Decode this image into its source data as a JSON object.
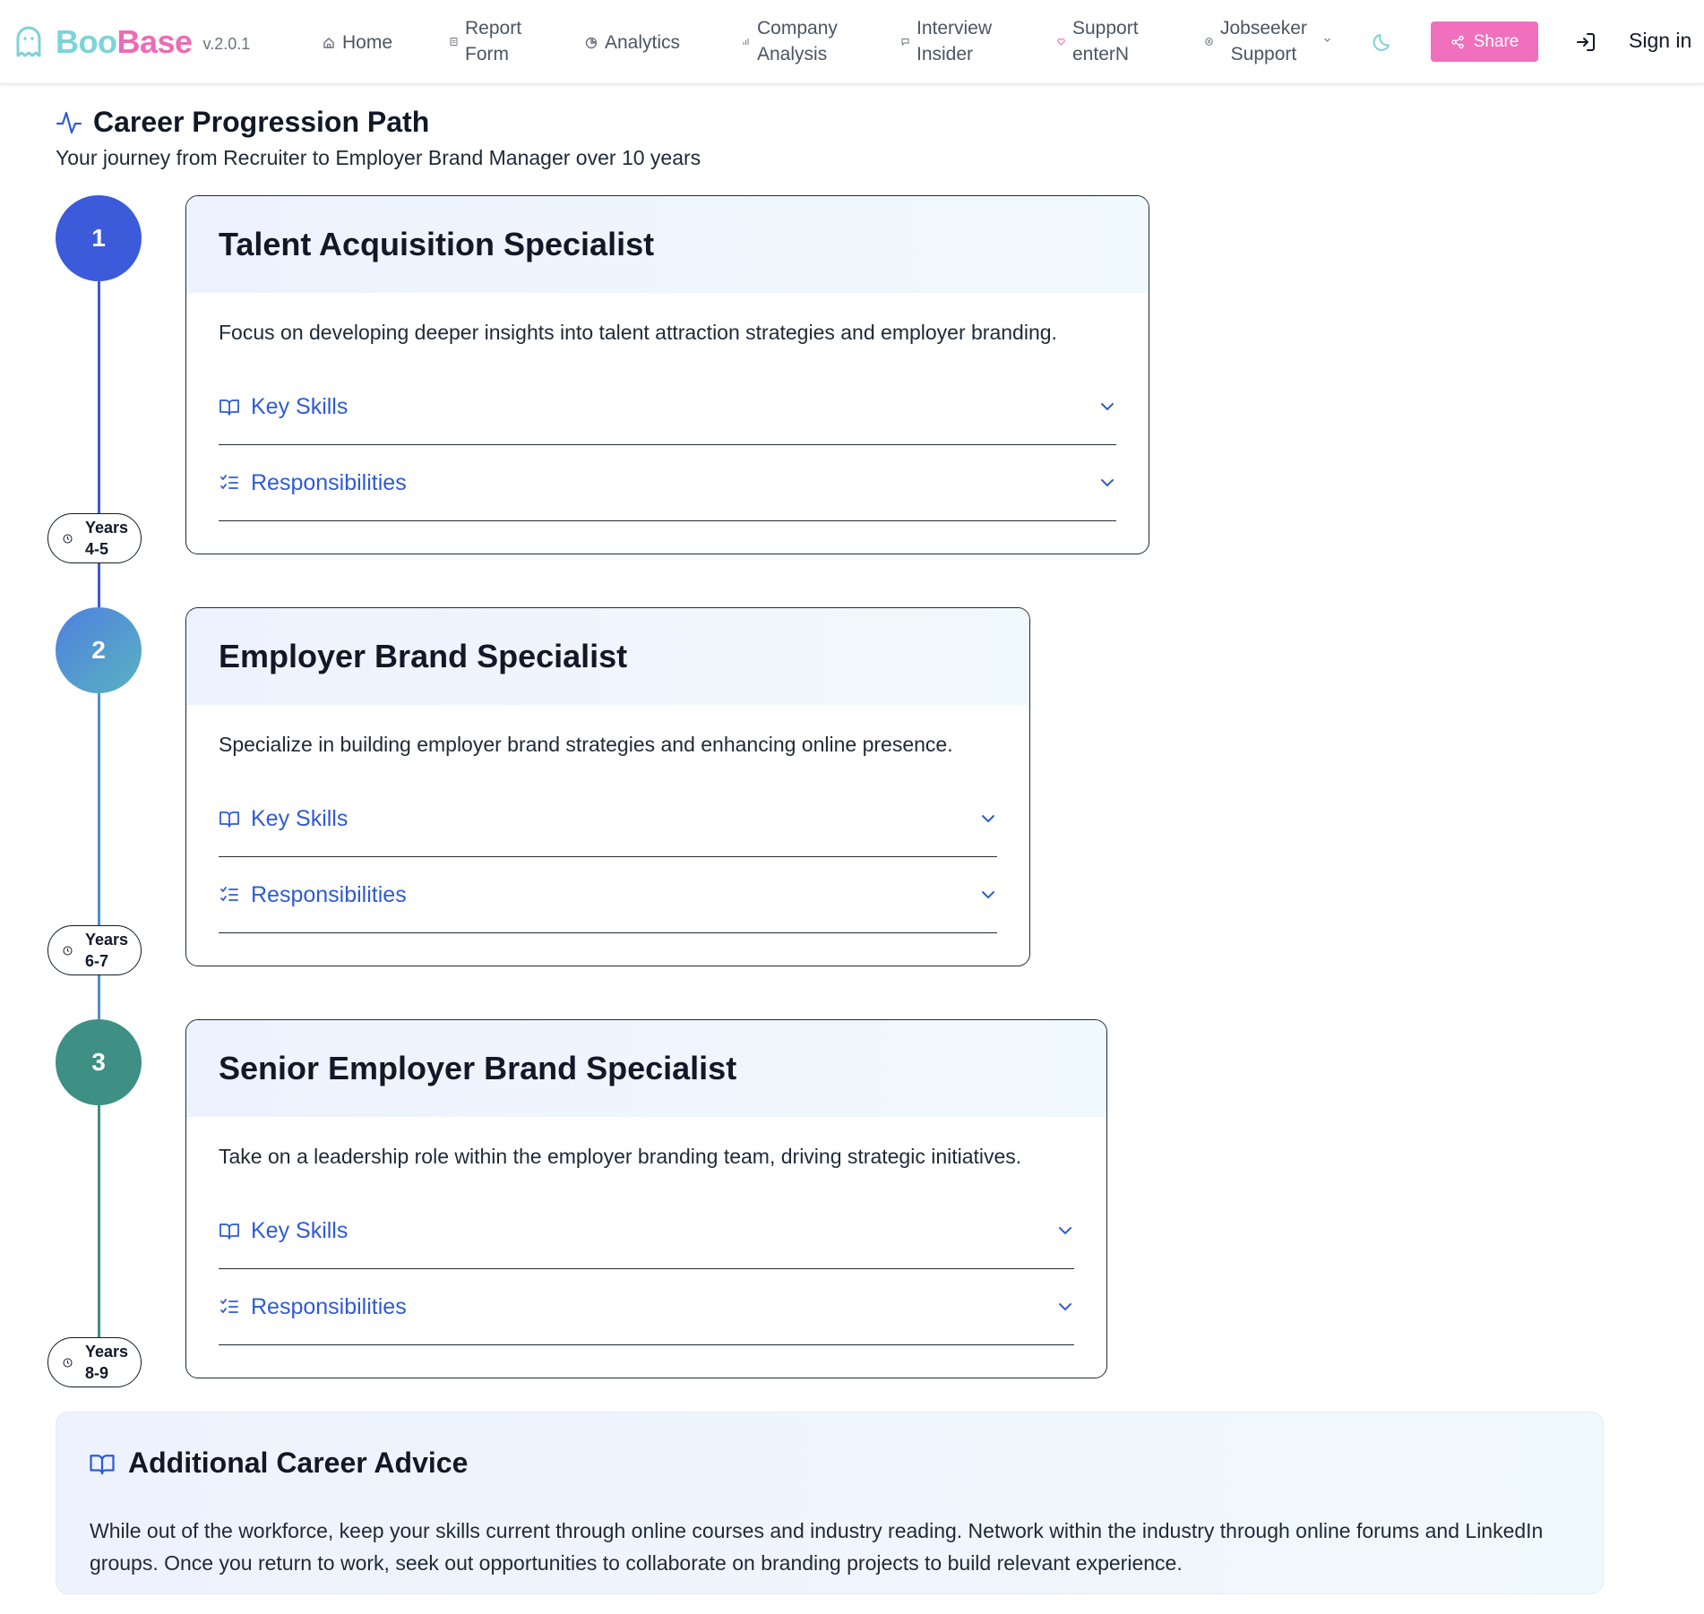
{
  "brand": {
    "boo": "Boo",
    "base": "Base",
    "version": "v.2.0.1"
  },
  "nav": [
    {
      "label": "Home",
      "line1": "Home",
      "line2": ""
    },
    {
      "label": "Report Form",
      "line1": "Report",
      "line2": "Form"
    },
    {
      "label": "Analytics",
      "line1": "Analytics",
      "line2": ""
    },
    {
      "label": "Company Analysis",
      "line1": "Company",
      "line2": "Analysis"
    },
    {
      "label": "Interview Insider",
      "line1": "Interview",
      "line2": "Insider"
    },
    {
      "label": "Support enterN",
      "line1": "Support",
      "line2": "enterN"
    },
    {
      "label": "Jobseeker Support",
      "line1": "Jobseeker",
      "line2": "Support"
    }
  ],
  "header_actions": {
    "share_label": "Share",
    "signin_label": "Sign in"
  },
  "page": {
    "title": "Career Progression Path",
    "subtitle": "Your journey from Recruiter to Employer Brand Manager over 10 years"
  },
  "timeline": [
    {
      "step": "1",
      "years_line1": "Years",
      "years_line2": "4-5",
      "title": "Talent Acquisition Specialist",
      "description": "Focus on developing deeper insights into talent attraction strategies and employer branding.",
      "skills_label": "Key Skills",
      "responsibilities_label": "Responsibilities"
    },
    {
      "step": "2",
      "years_line1": "Years",
      "years_line2": "6-7",
      "title": "Employer Brand Specialist",
      "description": "Specialize in building employer brand strategies and enhancing online presence.",
      "skills_label": "Key Skills",
      "responsibilities_label": "Responsibilities"
    },
    {
      "step": "3",
      "years_line1": "Years",
      "years_line2": "8-9",
      "title": "Senior Employer Brand Specialist",
      "description": "Take on a leadership role within the employer branding team, driving strategic initiatives.",
      "skills_label": "Key Skills",
      "responsibilities_label": "Responsibilities"
    }
  ],
  "advice": {
    "title": "Additional Career Advice",
    "text": "While out of the workforce, keep your skills current through online courses and industry reading. Network within the industry through online forums and LinkedIn groups. Once you return to work, seek out opportunities to collaborate on branding projects to build relevant experience."
  },
  "colors": {
    "brand_teal": "#7dd3d8",
    "brand_pink": "#ec6bb6",
    "share_button": "#f070bd",
    "accent_blue": "#2f5bd3",
    "step1": "#3b5bdb",
    "step2_gradient": [
      "#4f7fe0",
      "#59b3c0"
    ],
    "step3": "#3e8f84"
  }
}
